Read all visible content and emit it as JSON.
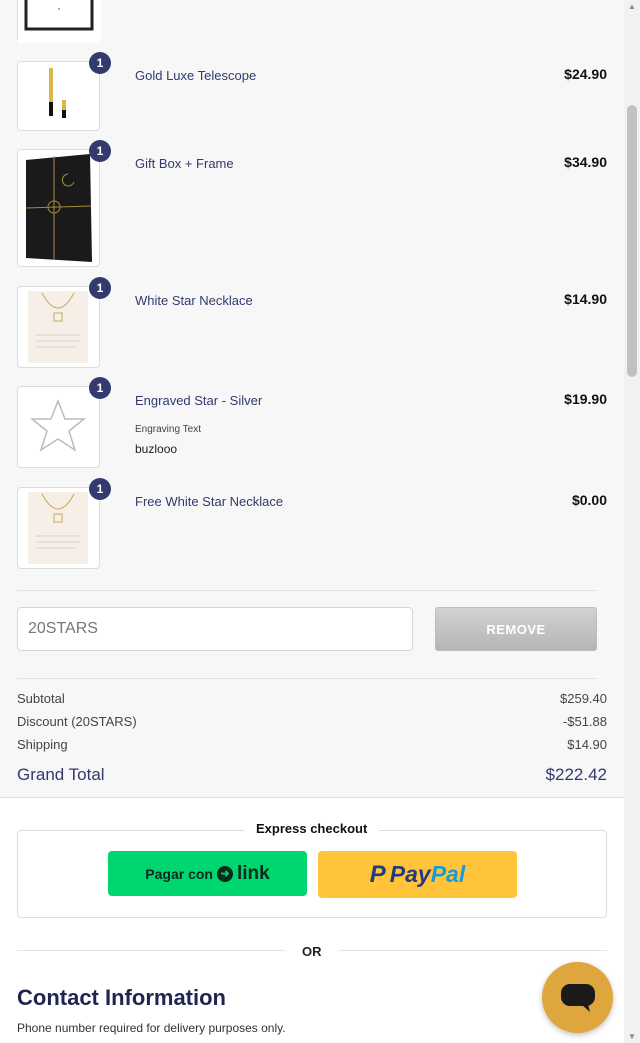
{
  "cart": {
    "items": [
      {
        "name": "Gold Luxe Telescope",
        "price": "$24.90",
        "qty": "1",
        "icon": "telescope-image"
      },
      {
        "name": "Gift Box + Frame",
        "price": "$34.90",
        "qty": "1",
        "icon": "gift-box-image"
      },
      {
        "name": "White Star Necklace",
        "price": "$14.90",
        "qty": "1",
        "icon": "necklace-image"
      },
      {
        "name": "Engraved Star - Silver",
        "price": "$19.90",
        "qty": "1",
        "icon": "star-outline-image",
        "property_label": "Engraving Text",
        "property_value": "buzlooo"
      },
      {
        "name": "Free White Star Necklace",
        "price": "$0.00",
        "qty": "1",
        "icon": "necklace-image"
      }
    ]
  },
  "coupon": {
    "code": "20STARS",
    "remove_label": "REMOVE"
  },
  "totals": {
    "subtotal_label": "Subtotal",
    "subtotal": "$259.40",
    "discount_label": "Discount (20STARS)",
    "discount": "-$51.88",
    "shipping_label": "Shipping",
    "shipping": "$14.90",
    "grand_label": "Grand Total",
    "grand": "$222.42"
  },
  "express": {
    "title": "Express checkout",
    "link_prefix": "Pagar con",
    "link_word": "link",
    "paypal_pay": "Pay",
    "paypal_pal": "Pal"
  },
  "divider_or": "OR",
  "contact": {
    "title": "Contact Information",
    "note": "Phone number required for delivery purposes only."
  },
  "colors": {
    "accent": "#323a6e",
    "link_green": "#00d66f",
    "paypal_yellow": "#ffc439",
    "chat_button": "#e0a63e"
  }
}
